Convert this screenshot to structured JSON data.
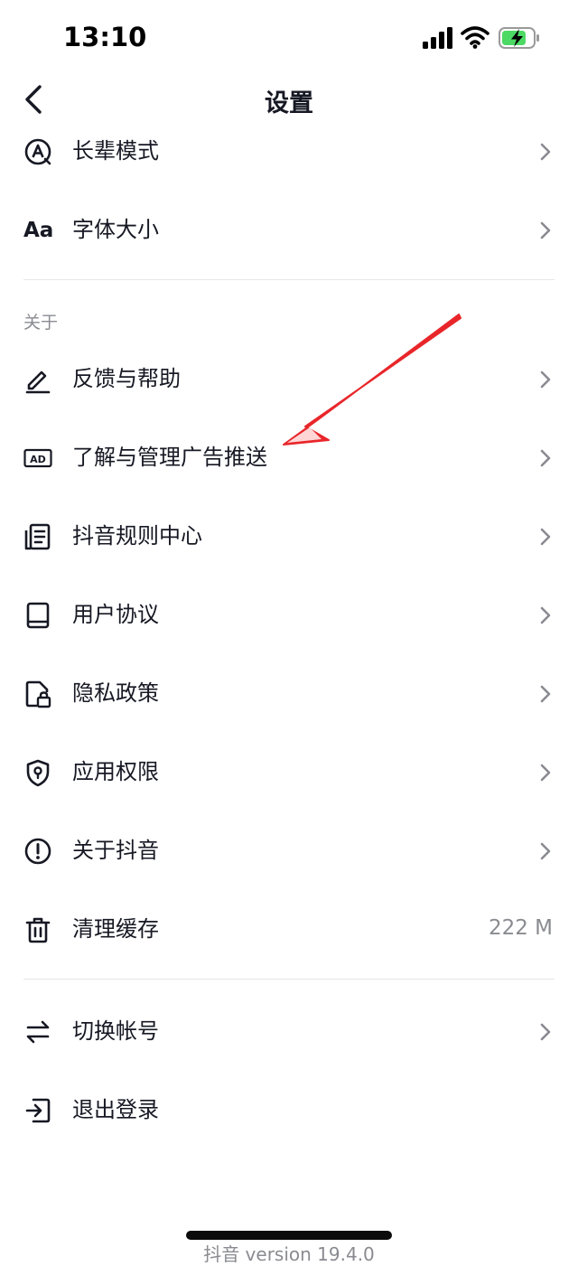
{
  "status_bar": {
    "time": "13:10"
  },
  "header": {
    "title": "设置"
  },
  "section_about": {
    "label": "关于"
  },
  "items": [
    {
      "label": "长辈模式",
      "icon": "elder-mode-icon"
    },
    {
      "label": "字体大小",
      "icon_text": "Aa"
    },
    {
      "label": "反馈与帮助",
      "icon": "pencil-icon"
    },
    {
      "label": "了解与管理广告推送",
      "icon_text": "AD"
    },
    {
      "label": "抖音规则中心",
      "icon": "document-icon"
    },
    {
      "label": "用户协议",
      "icon": "book-icon"
    },
    {
      "label": "隐私政策",
      "icon": "lock-icon"
    },
    {
      "label": "应用权限",
      "icon": "shield-icon"
    },
    {
      "label": "关于抖音",
      "icon": "info-icon"
    },
    {
      "label": "清理缓存",
      "icon": "trash-icon",
      "value": "222 M"
    },
    {
      "label": "切换帐号",
      "icon": "swap-icon"
    },
    {
      "label": "退出登录",
      "icon": "logout-icon"
    }
  ],
  "footer": {
    "version": "抖音 version 19.4.0"
  },
  "colors": {
    "text": "#161823",
    "secondary": "#8a8b91",
    "divider": "#e6e6e8",
    "annotation": "#e8262a",
    "battery": "#4cd964"
  }
}
